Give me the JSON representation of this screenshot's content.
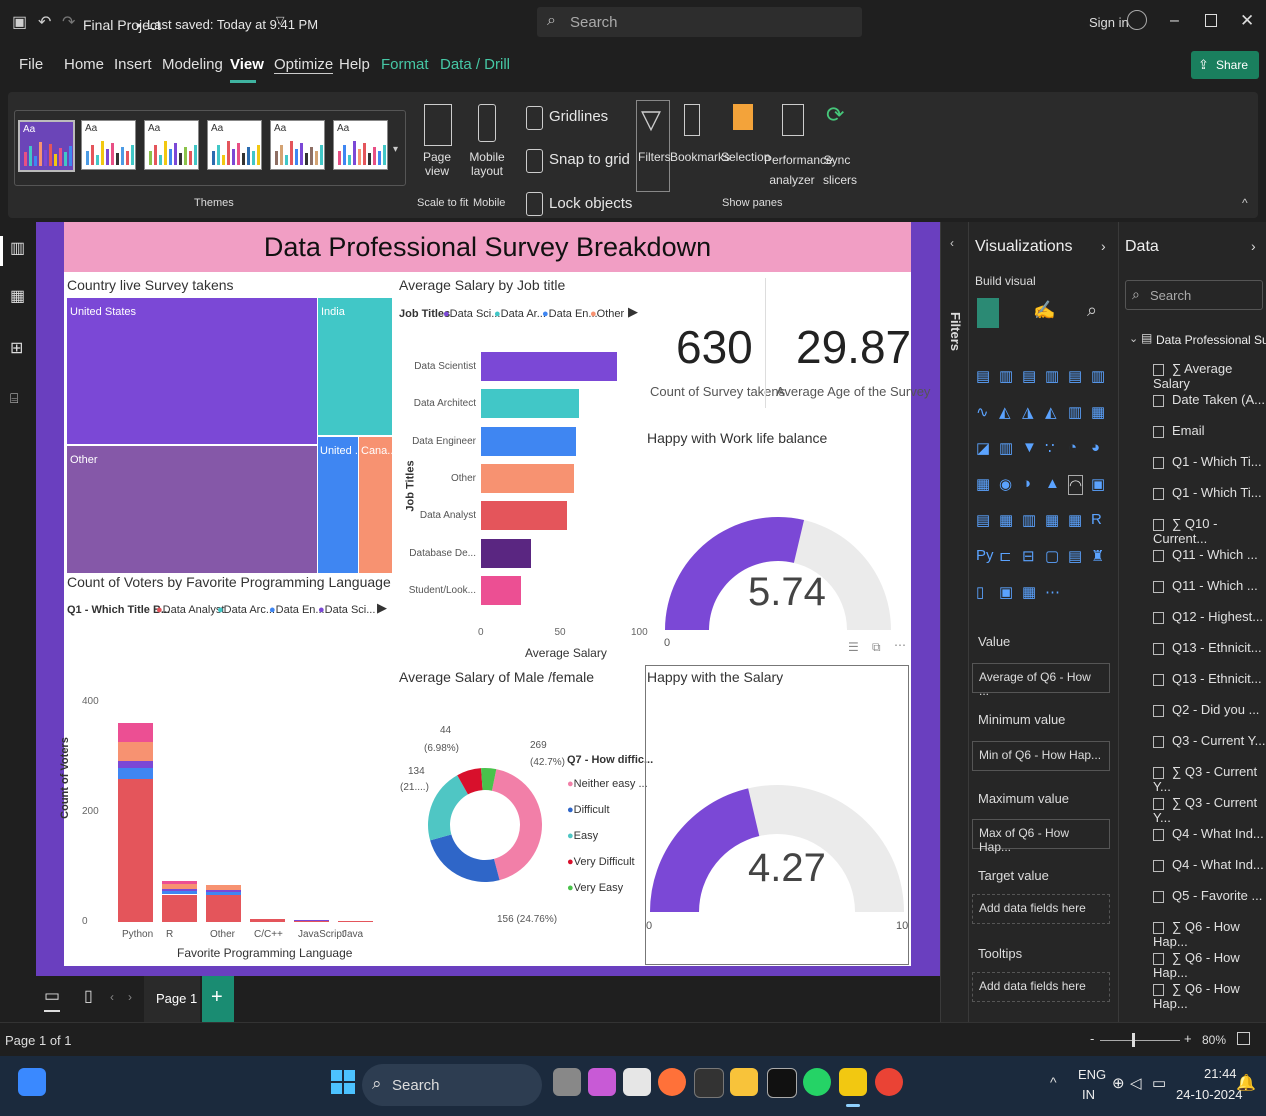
{
  "titlebar": {
    "title": "Final Project",
    "saved": "Last saved: Today at 9:41 PM",
    "search_placeholder": "Search",
    "sign_in": "Sign in",
    "share": "Share"
  },
  "menu": [
    "File",
    "Home",
    "Insert",
    "Modeling",
    "View",
    "Optimize",
    "Help",
    "Format",
    "Data / Drill"
  ],
  "ribbon": {
    "themes_label": "Themes",
    "page_view": "Page view",
    "mobile_layout": "Mobile layout",
    "scale_to_fit": "Scale to fit",
    "mobile": "Mobile",
    "gridlines": "Gridlines",
    "snap_to_grid": "Snap to grid",
    "lock_objects": "Lock objects",
    "filters": "Filters",
    "bookmarks": "Bookmarks",
    "selection": "Selection",
    "performance_analyzer": "Performance analyzer",
    "sync_slicers": "Sync slicers",
    "show_panes": "Show panes",
    "theme_aa": "Aa"
  },
  "report": {
    "title": "Data Professional Survey Breakdown",
    "treemap": {
      "title": "Country live Survey takens",
      "cells": [
        "United States",
        "India",
        "Other",
        "United ...",
        "Cana..."
      ]
    },
    "salary_by_job": {
      "title": "Average Salary by Job title",
      "legend_title": "Job Titles",
      "legend": [
        "Data Sci...",
        "Data Ar...",
        "Data En...",
        "Other"
      ],
      "y_axis_title": "Job Titles",
      "x_axis_title": "Average Salary",
      "x_ticks": [
        "0",
        "50",
        "100"
      ]
    },
    "card_count": {
      "value": "630",
      "label": "Count of Survey takens"
    },
    "card_age": {
      "value": "29.87",
      "label": "Average Age of the Survey"
    },
    "gauge1": {
      "title": "Happy with Work life balance",
      "value": "5.74",
      "min": "0"
    },
    "gauge2": {
      "title": "Happy with the Salary",
      "value": "4.27",
      "min": "0",
      "max": "10"
    },
    "prog_lang": {
      "title": "Count of Voters by Favorite Programming Language",
      "legend_title": "Q1 - Which Title B...",
      "legend": [
        "Data Analyst",
        "Data Arc...",
        "Data En...",
        "Data Sci..."
      ],
      "y_axis_title": "Count of Voters",
      "x_axis_title": "Favorite Programming Language",
      "y_ticks": [
        "400",
        "200",
        "0"
      ]
    },
    "donut": {
      "title": "Average Salary of Male /female",
      "legend_title": "Q7 - How diffic...",
      "legend": [
        "Neither easy ...",
        "Difficult",
        "Easy",
        "Very Difficult",
        "Very Easy"
      ],
      "labels": {
        "top": "44",
        "top_pct": "(6.98%)",
        "right": "269",
        "right_pct": "(42.7%)",
        "left": "134",
        "left_pct": "(21....)",
        "bottom": "156 (24.76%)"
      }
    }
  },
  "filters_pane": {
    "label": "Filters"
  },
  "viz_pane": {
    "title": "Visualizations",
    "build_visual": "Build visual",
    "value": "Value",
    "value_field": "Average of Q6 - How ...",
    "min_label": "Minimum value",
    "min_field": "Min of Q6 - How Hap...",
    "max_label": "Maximum value",
    "max_field": "Max of Q6 - How Hap...",
    "target_label": "Target value",
    "target_placeholder": "Add data fields here",
    "tooltips_label": "Tooltips",
    "tooltips_placeholder": "Add data fields here"
  },
  "data_pane": {
    "title": "Data",
    "search_placeholder": "Search",
    "table_name": "Data Professional Su...",
    "fields": [
      "Average Salary",
      "Date Taken (A...",
      "Email",
      "Q1 - Which Ti...",
      "Q1 - Which Ti...",
      "Q10 - Current...",
      "Q11 - Which ...",
      "Q11 - Which ...",
      "Q12 - Highest...",
      "Q13 - Ethnicit...",
      "Q13 - Ethnicit...",
      "Q2 - Did you ...",
      "Q3 - Current Y...",
      "Q3 - Current Y...",
      "Q3 - Current Y...",
      "Q4 - What Ind...",
      "Q4 - What Ind...",
      "Q5 - Favorite ...",
      "Q6 - How Hap...",
      "Q6 - How Hap...",
      "Q6 - How Hap..."
    ]
  },
  "pages": {
    "tab": "Page 1",
    "status": "Page 1 of 1",
    "zoom": "80%"
  },
  "taskbar": {
    "search": "Search",
    "lang": "ENG",
    "region": "IN",
    "time": "21:44",
    "date": "24-10-2024"
  },
  "chart_data": [
    {
      "type": "bar",
      "title": "Average Salary by Job title",
      "categories": [
        "Data Scientist",
        "Data Architect",
        "Data Engineer",
        "Other",
        "Data Analyst",
        "Database De...",
        "Student/Look..."
      ],
      "values": [
        89,
        64,
        62,
        61,
        56,
        33,
        26
      ],
      "xlabel": "Average Salary",
      "ylabel": "Job Titles",
      "xlim": [
        0,
        100
      ],
      "colors": [
        "#7b48d6",
        "#41c7c7",
        "#3f86f2",
        "#f79271",
        "#e4555b",
        "#5a2681",
        "#ec4f93"
      ]
    },
    {
      "type": "bar",
      "title": "Count of Voters by Favorite Programming Language",
      "categories": [
        "Python",
        "R",
        "Other",
        "C/C++",
        "JavaScript",
        "Java"
      ],
      "series": [
        {
          "name": "Data Analyst",
          "values": [
            260,
            50,
            50,
            5,
            2,
            1
          ]
        },
        {
          "name": "Data Arc...",
          "values": [
            0,
            0,
            0,
            0,
            0,
            0
          ]
        },
        {
          "name": "Data En...",
          "values": [
            20,
            6,
            5,
            0,
            1,
            0
          ]
        },
        {
          "name": "Data Sci...",
          "values": [
            12,
            4,
            4,
            0,
            1,
            0
          ]
        },
        {
          "name": "",
          "values": [
            35,
            10,
            9,
            0,
            0,
            0
          ]
        },
        {
          "name": "",
          "values": [
            35,
            5,
            0,
            0,
            0,
            0
          ]
        }
      ],
      "xlabel": "Favorite Programming Language",
      "ylabel": "Count of Voters",
      "ylim": [
        0,
        440
      ]
    },
    {
      "type": "pie",
      "title": "Average Salary of Male /female",
      "categories": [
        "Neither easy ...",
        "Difficult",
        "Easy",
        "Very Difficult",
        "Very Easy"
      ],
      "values": [
        269,
        156,
        134,
        44,
        27
      ],
      "colors": [
        "#f27fa8",
        "#2f66c8",
        "#4fc6c4",
        "#d8102c",
        "#49c24b"
      ]
    }
  ]
}
